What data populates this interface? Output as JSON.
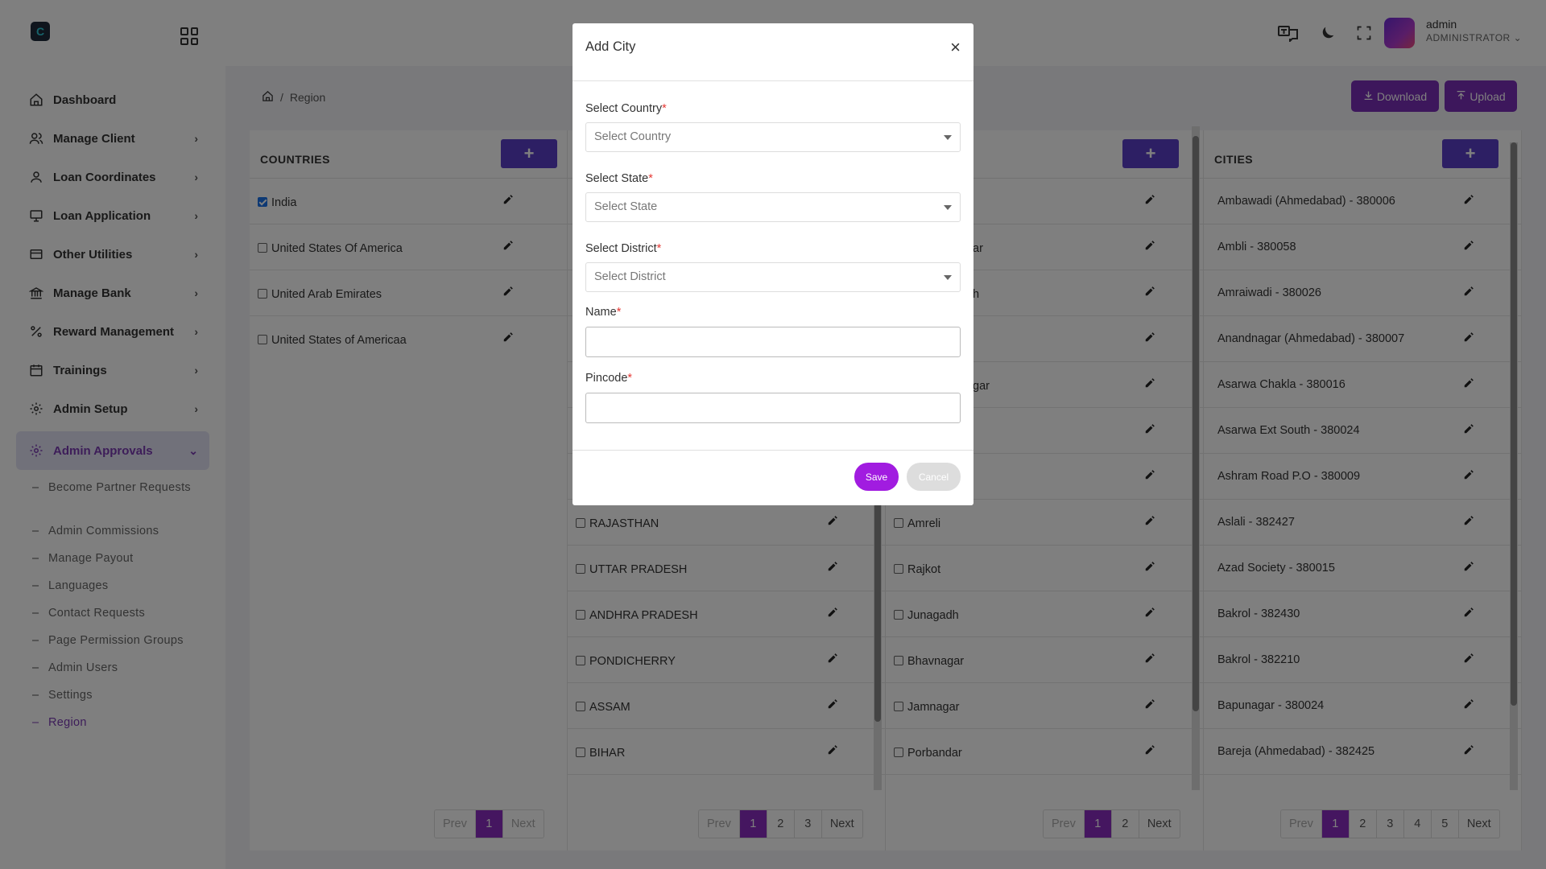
{
  "app": {
    "logo_letter": "C"
  },
  "sidebar": {
    "items": [
      {
        "label": "Dashboard",
        "icon": "home-icon"
      },
      {
        "label": "Manage Client",
        "icon": "users-icon"
      },
      {
        "label": "Loan Coordinates",
        "icon": "user-icon"
      },
      {
        "label": "Loan Application",
        "icon": "monitor-icon"
      },
      {
        "label": "Other Utilities",
        "icon": "card-icon"
      },
      {
        "label": "Manage Bank",
        "icon": "bank-icon"
      },
      {
        "label": "Reward Management",
        "icon": "percent-icon"
      },
      {
        "label": "Trainings",
        "icon": "calendar-icon"
      },
      {
        "label": "Admin Setup",
        "icon": "gear-icon"
      },
      {
        "label": "Admin Approvals",
        "icon": "gear-icon"
      }
    ],
    "subitems": [
      "Become Partner Requests",
      "Admin Commissions",
      "Manage Payout",
      "Languages",
      "Contact Requests",
      "Page Permission Groups",
      "Admin Users",
      "Settings",
      "Region"
    ]
  },
  "user": {
    "name": "admin",
    "role": "ADMINISTRATOR"
  },
  "breadcrumb": {
    "separator": "/",
    "current": "Region"
  },
  "actions": {
    "download": "Download",
    "upload": "Upload"
  },
  "panels": {
    "countries": {
      "title": "COUNTRIES",
      "rows": [
        {
          "label": "India",
          "checked": true
        },
        {
          "label": "United States Of America",
          "checked": false
        },
        {
          "label": "United Arab Emirates",
          "checked": false
        },
        {
          "label": "United States of Americaa",
          "checked": false
        }
      ],
      "pager": {
        "prev": "Prev",
        "pages": [
          "1"
        ],
        "next": "Next"
      }
    },
    "states": {
      "rows": [
        "RAJASTHAN",
        "UTTAR PRADESH",
        "ANDHRA PRADESH",
        "PONDICHERRY",
        "ASSAM",
        "BIHAR"
      ],
      "pager": {
        "prev": "Prev",
        "pages": [
          "1",
          "2",
          "3"
        ],
        "next": "Next"
      }
    },
    "districts": {
      "partial_rows": [
        "ar",
        "h",
        "gar"
      ],
      "rows": [
        "Amreli",
        "Rajkot",
        "Junagadh",
        "Bhavnagar",
        "Jamnagar",
        "Porbandar"
      ],
      "pager": {
        "prev": "Prev",
        "pages": [
          "1",
          "2"
        ],
        "next": "Next"
      }
    },
    "cities": {
      "title": "CITIES",
      "rows": [
        "Ambawadi (Ahmedabad) - 380006",
        "Ambli - 380058",
        "Amraiwadi - 380026",
        "Anandnagar (Ahmedabad) - 380007",
        "Asarwa Chakla - 380016",
        "Asarwa Ext South - 380024",
        "Ashram Road P.O - 380009",
        "Aslali - 382427",
        "Azad Society - 380015",
        "Bakrol - 382430",
        "Bakrol - 382210",
        "Bapunagar - 380024",
        "Bareja (Ahmedabad) - 382425"
      ],
      "pager": {
        "prev": "Prev",
        "pages": [
          "1",
          "2",
          "3",
          "4",
          "5"
        ],
        "next": "Next"
      }
    }
  },
  "modal": {
    "title": "Add City",
    "close": "×",
    "fields": {
      "country": {
        "label": "Select Country",
        "placeholder": "Select Country"
      },
      "state": {
        "label": "Select State",
        "placeholder": "Select State"
      },
      "district": {
        "label": "Select District",
        "placeholder": "Select District"
      },
      "name": {
        "label": "Name"
      },
      "pincode": {
        "label": "Pincode"
      }
    },
    "required_mark": "*",
    "save": "Save",
    "cancel": "Cancel"
  },
  "colors": {
    "accent": "#7b2fb8",
    "add_button": "#5b3fc8",
    "save": "#a11ce0",
    "required": "#e53935"
  }
}
